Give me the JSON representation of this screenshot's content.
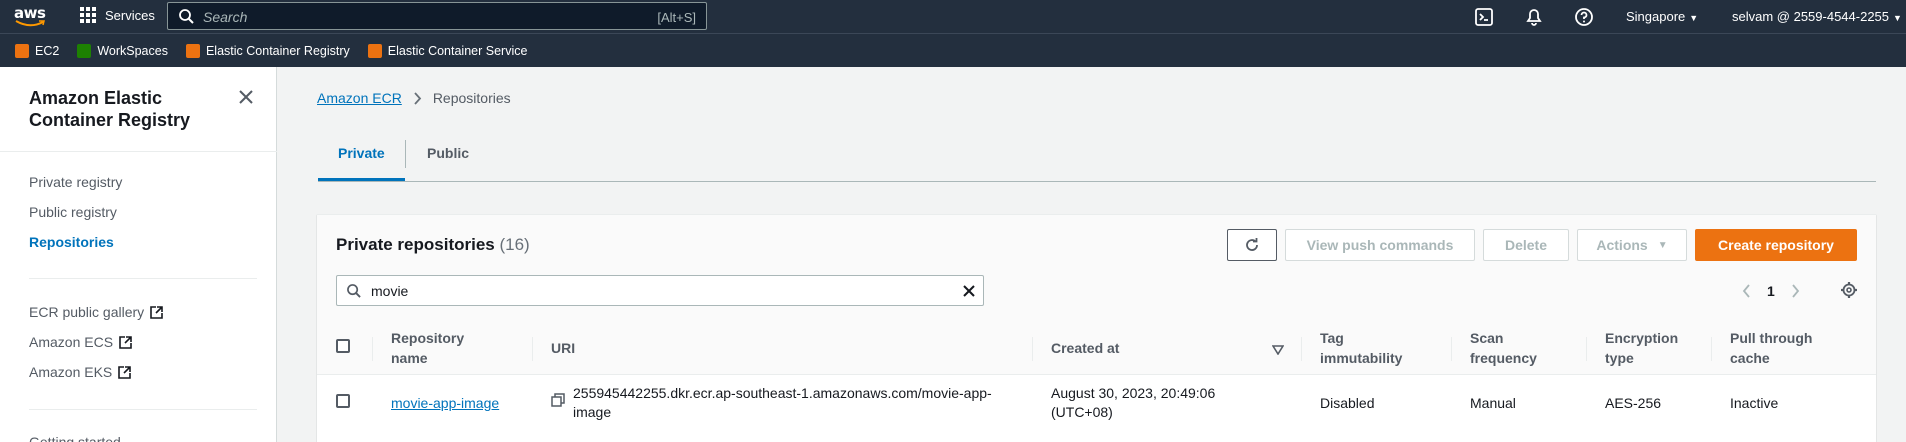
{
  "topbar": {
    "logo": "aws",
    "services_label": "Services",
    "search_placeholder": "Search",
    "search_shortcut": "[Alt+S]",
    "region": "Singapore",
    "account": "selvam @ 2559-4544-2255",
    "icons": [
      "cloudshell-icon",
      "notifications-icon",
      "help-icon"
    ]
  },
  "favorites": [
    {
      "label": "EC2",
      "color": "#ec7211"
    },
    {
      "label": "WorkSpaces",
      "color": "#1d8102"
    },
    {
      "label": "Elastic Container Registry",
      "color": "#ec7211"
    },
    {
      "label": "Elastic Container Service",
      "color": "#ec7211"
    }
  ],
  "sidenav": {
    "title": "Amazon Elastic Container Registry",
    "items": [
      {
        "label": "Private registry"
      },
      {
        "label": "Public registry"
      },
      {
        "label": "Repositories",
        "active": true
      }
    ],
    "external": [
      {
        "label": "ECR public gallery"
      },
      {
        "label": "Amazon ECS"
      },
      {
        "label": "Amazon EKS"
      }
    ],
    "partial_item": "Getting started"
  },
  "breadcrumb": {
    "root": "Amazon ECR",
    "current": "Repositories"
  },
  "tabs": [
    {
      "label": "Private",
      "active": true
    },
    {
      "label": "Public"
    }
  ],
  "panel": {
    "title": "Private repositories",
    "count": "(16)",
    "buttons": {
      "view_push": "View push commands",
      "delete": "Delete",
      "actions": "Actions",
      "create": "Create repository"
    },
    "filter_value": "movie",
    "page": "1"
  },
  "table": {
    "headers": [
      "Repository name",
      "URI",
      "Created at",
      "Tag immutability",
      "Scan frequency",
      "Encryption type",
      "Pull through cache"
    ],
    "rows": [
      {
        "name": "movie-app-image",
        "uri": "255945442255.dkr.ecr.ap-southeast-1.amazonaws.com/movie-app-image",
        "created": "August 30, 2023, 20:49:06 (UTC+08)",
        "tag_immutability": "Disabled",
        "scan_frequency": "Manual",
        "encryption": "AES-256",
        "pull_through_cache": "Inactive"
      }
    ]
  },
  "colors": {
    "nav_bg": "#232f3e",
    "link": "#0073bb",
    "primary": "#ec7211"
  }
}
